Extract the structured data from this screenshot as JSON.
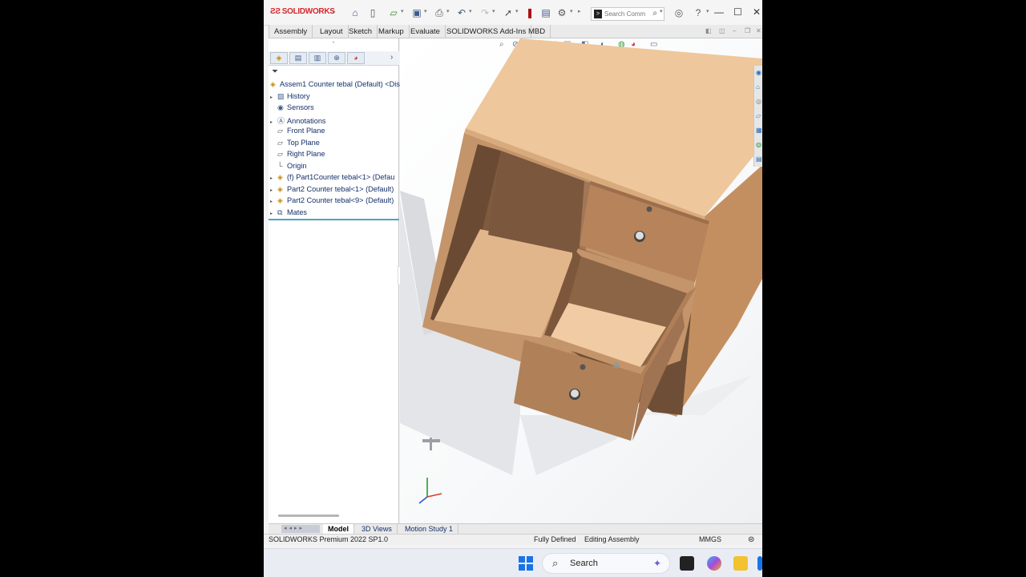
{
  "app": {
    "brand": "SOLIDWORKS",
    "search_placeholder": "Search Comm"
  },
  "tabs": [
    "Assembly",
    "Layout",
    "Sketch",
    "Markup",
    "Evaluate",
    "SOLIDWORKS Add-Ins",
    "MBD"
  ],
  "tree": {
    "root": "Assem1 Counter tebal (Default) <Dis",
    "items": [
      {
        "label": "History",
        "icon": "history-icon",
        "expandable": true
      },
      {
        "label": "Sensors",
        "icon": "sensors-icon",
        "expandable": false
      },
      {
        "label": "Annotations",
        "icon": "annotations-icon",
        "expandable": true
      },
      {
        "label": "Front Plane",
        "icon": "plane-icon",
        "expandable": false
      },
      {
        "label": "Top Plane",
        "icon": "plane-icon",
        "expandable": false
      },
      {
        "label": "Right Plane",
        "icon": "plane-icon",
        "expandable": false
      },
      {
        "label": "Origin",
        "icon": "origin-icon",
        "expandable": false
      },
      {
        "label": "(f) Part1Counter tebal<1> (Defau",
        "icon": "part-icon",
        "expandable": true
      },
      {
        "label": "Part2 Counter tebal<1> (Default)",
        "icon": "part-icon",
        "expandable": true
      },
      {
        "label": "Part2 Counter tebal<9> (Default)",
        "icon": "part-icon",
        "expandable": true
      },
      {
        "label": "Mates",
        "icon": "mates-icon",
        "expandable": true
      }
    ]
  },
  "bottom_tabs": {
    "model": "Model",
    "views3d": "3D Views",
    "motion": "Motion Study 1"
  },
  "status": {
    "version": "SOLIDWORKS Premium 2022 SP1.0",
    "defined": "Fully Defined",
    "editing": "Editing Assembly",
    "units": "MMGS"
  },
  "taskbar": {
    "search_label": "Search"
  },
  "colors": {
    "wood_top": "#efc79c",
    "wood_side": "#c78f5e",
    "wood_dark": "#8e6644",
    "accent": "#4fa1c6"
  }
}
